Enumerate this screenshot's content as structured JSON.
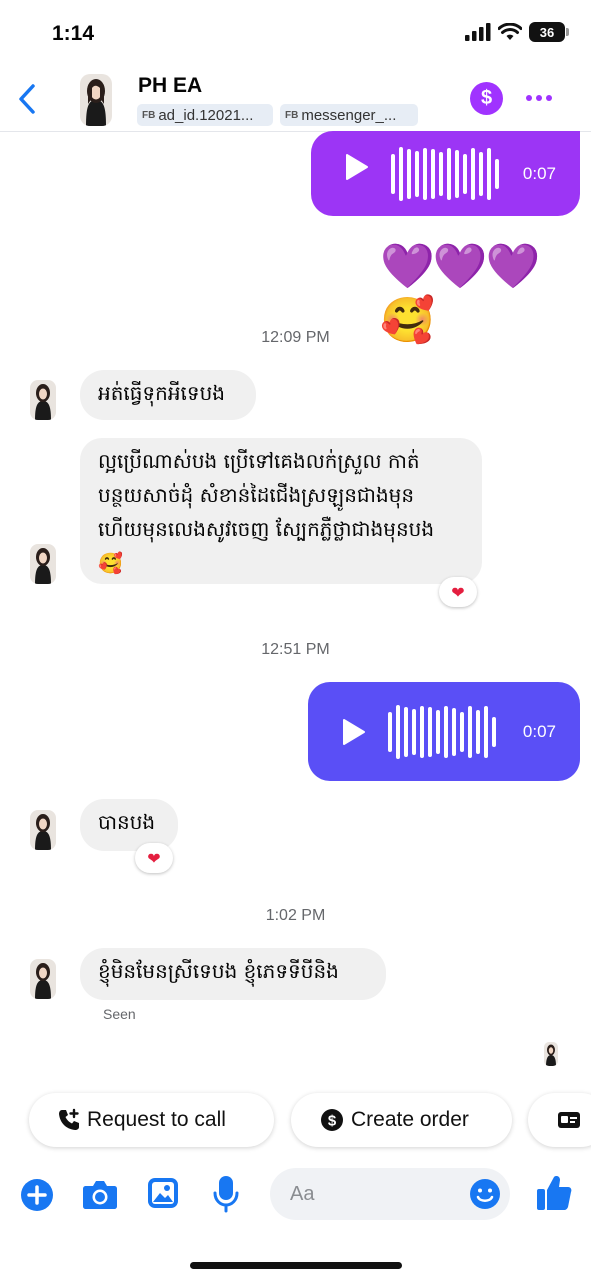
{
  "status_bar": {
    "time": "1:14",
    "battery": "36"
  },
  "header": {
    "name": "PH EA",
    "chips": [
      {
        "prefix": "FB",
        "label": "ad_id.12021..."
      },
      {
        "prefix": "FB",
        "label": "messenger_..."
      }
    ],
    "icons": {
      "back": "chevron-left-icon",
      "payment": "dollar-icon",
      "more": "more-horizontal-icon"
    }
  },
  "messages": {
    "voice1": {
      "duration": "0:07"
    },
    "emoji_reply": "💜💜💜🥰",
    "time1": "12:09 PM",
    "text1": "អត់ធ្វើទុកអីទេបង",
    "text2": "ល្អប្រើណាស់បង ប្រើទៅគេងលក់ស្រួល កាត់បន្ថយសាច់ដុំ សំខាន់ដៃជើងស្រឡូនជាងមុន ហើយមុនលេងសូវចេញ ស្បែកភ្លឺថ្លាជាងមុនបង 🥰",
    "reaction2": "❤",
    "time2": "12:51 PM",
    "voice2": {
      "duration": "0:07"
    },
    "text3": "បានបង",
    "reaction3": "❤",
    "time3": "1:02 PM",
    "text4": "ខ្ញុំមិនមែនស្រីទេបង ខ្ញុំភេទទីបីនិង",
    "seen_label": "Seen"
  },
  "quick_actions": {
    "request_call": "Request to call",
    "create_order": "Create order"
  },
  "composer": {
    "placeholder": "Aa"
  },
  "colors": {
    "accent": "#1877f2",
    "voice_purple": "#9c35f5",
    "voice_indigo": "#5a4ff6",
    "payment": "#a033ff"
  }
}
